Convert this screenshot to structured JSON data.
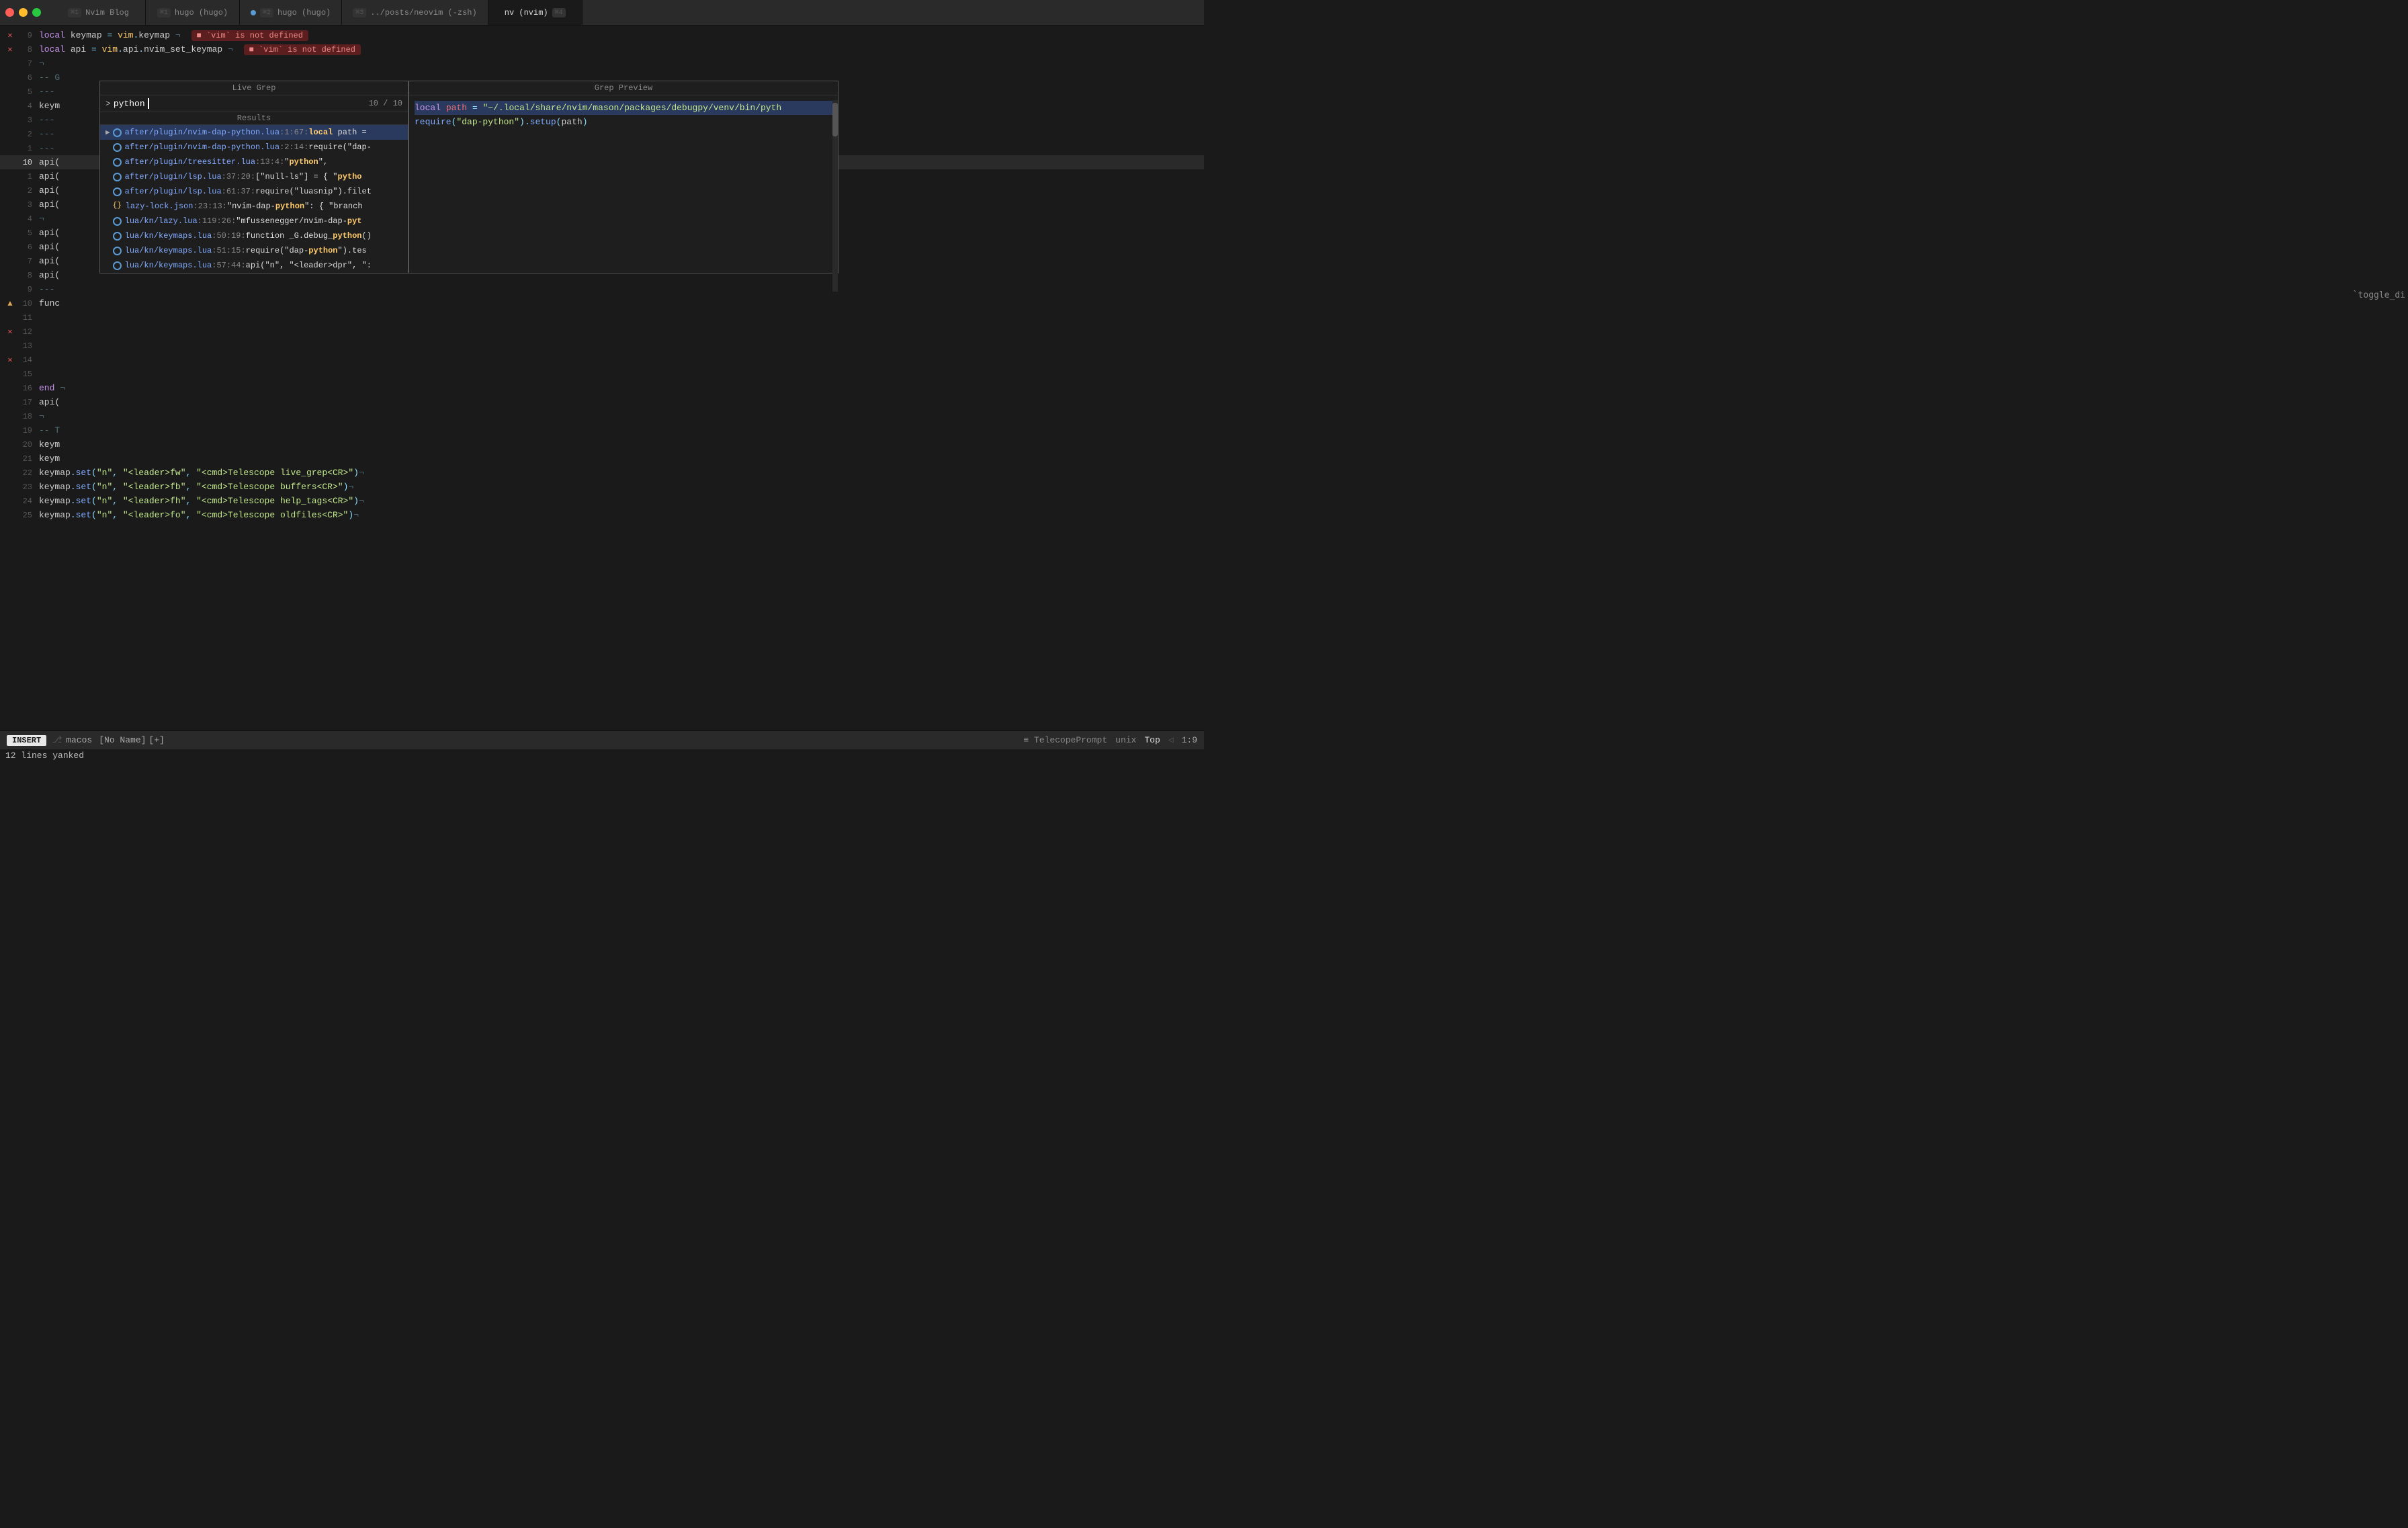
{
  "titlebar": {
    "tabs": [
      {
        "label": "Nvim Blog",
        "kbd": "⌘1",
        "active": false,
        "dot": false
      },
      {
        "label": "hugo (hugo)",
        "kbd": "⌘1",
        "active": false,
        "dot": false
      },
      {
        "label": "hugo (hugo)",
        "kbd": "⌘2",
        "active": false,
        "dot": true
      },
      {
        "label": "../posts/neovim (-zsh)",
        "kbd": "⌘3",
        "active": false,
        "dot": false
      },
      {
        "label": "nv (nvim)",
        "kbd": "⌘4",
        "active": true,
        "dot": false
      }
    ]
  },
  "editor": {
    "lines": [
      {
        "num": 9,
        "sign": "x",
        "content": "local keymap = vim.keymap",
        "error": "'vim' is not defined"
      },
      {
        "num": 8,
        "sign": "x",
        "content": "local api = vim.api.nvim_set_keymap",
        "error": "'vim' is not defined"
      },
      {
        "num": 7,
        "sign": "",
        "content": "¬"
      },
      {
        "num": 6,
        "sign": "",
        "content": "-- G"
      },
      {
        "num": 5,
        "sign": "",
        "content": "---"
      },
      {
        "num": 4,
        "sign": "",
        "content": "keym"
      },
      {
        "num": 3,
        "sign": "",
        "content": "---"
      },
      {
        "num": 2,
        "sign": "",
        "content": "---"
      },
      {
        "num": 1,
        "sign": "",
        "content": "---"
      },
      {
        "num": 10,
        "sign": "",
        "content": "api(",
        "current": true
      },
      {
        "num": 1,
        "sign": "",
        "content": "api("
      },
      {
        "num": 2,
        "sign": "",
        "content": "api("
      },
      {
        "num": 3,
        "sign": "",
        "content": "api("
      },
      {
        "num": 4,
        "sign": "",
        "content": "¬"
      },
      {
        "num": 5,
        "sign": "",
        "content": "api("
      },
      {
        "num": 6,
        "sign": "",
        "content": "api("
      },
      {
        "num": 7,
        "sign": "",
        "content": "api("
      },
      {
        "num": 8,
        "sign": "",
        "content": "api("
      },
      {
        "num": 9,
        "sign": "",
        "content": "---"
      },
      {
        "num": 10,
        "sign": "warn",
        "content": "func"
      },
      {
        "num": 11,
        "sign": "",
        "content": ""
      },
      {
        "num": 12,
        "sign": "x",
        "content": ""
      },
      {
        "num": 13,
        "sign": "",
        "content": ""
      },
      {
        "num": 14,
        "sign": "x",
        "content": ""
      },
      {
        "num": 15,
        "sign": "",
        "content": ""
      },
      {
        "num": 16,
        "sign": "",
        "content": "end ¬"
      },
      {
        "num": 17,
        "sign": "",
        "content": "api("
      },
      {
        "num": 18,
        "sign": "",
        "content": "¬"
      },
      {
        "num": 19,
        "sign": "",
        "content": "-- T"
      },
      {
        "num": 20,
        "sign": "",
        "content": "keym"
      },
      {
        "num": 21,
        "sign": "",
        "content": "keym"
      },
      {
        "num": 22,
        "sign": "",
        "content": "keymap.set(\"n\", \"<leader>fw\", \"<cmd>Telescope live_grep<CR>\")¬"
      },
      {
        "num": 23,
        "sign": "",
        "content": "keymap.set(\"n\", \"<leader>fb\", \"<cmd>Telescope buffers<CR>\")¬"
      },
      {
        "num": 24,
        "sign": "",
        "content": "keymap.set(\"n\", \"<leader>fh\", \"<cmd>Telescope help_tags<CR>\")¬"
      },
      {
        "num": 25,
        "sign": "",
        "content": "keymap.set(\"n\", \"<leader>fo\", \"<cmd>Telescope oldfiles<CR>\")¬"
      }
    ]
  },
  "telescope": {
    "live_grep": {
      "title": "Live Grep",
      "query": "python",
      "count": "10 / 10"
    },
    "results": {
      "title": "Results",
      "items": [
        {
          "selected": true,
          "file": "after/plugin/nvim-dap-python.lua",
          "loc": "1:67:",
          "text": "local path ="
        },
        {
          "selected": false,
          "file": "after/plugin/nvim-dap-python.lua",
          "loc": "2:14:",
          "text": "require(\"dap-"
        },
        {
          "selected": false,
          "file": "after/plugin/treesitter.lua",
          "loc": "13:4:",
          "text": "\"python\","
        },
        {
          "selected": false,
          "file": "after/plugin/lsp.lua",
          "loc": "37:20:",
          "text": "[\"null-ls\"] = { \"pytho"
        },
        {
          "selected": false,
          "file": "after/plugin/lsp.lua",
          "loc": "61:37:",
          "text": "require(\"luasnip\").filet"
        },
        {
          "selected": false,
          "file": "{} lazy-lock.json",
          "loc": "23:13:",
          "text": "\"nvim-dap-python\": { \"branch"
        },
        {
          "selected": false,
          "file": "lua/kn/lazy.lua",
          "loc": "119:26:",
          "text": "\"mfussenegger/nvim-dap-pyt"
        },
        {
          "selected": false,
          "file": "lua/kn/keymaps.lua",
          "loc": "50:19:",
          "text": "function _G.debug_python()"
        },
        {
          "selected": false,
          "file": "lua/kn/keymaps.lua",
          "loc": "51:15:",
          "text": "require(\"dap-python\").tes"
        },
        {
          "selected": false,
          "file": "lua/kn/keymaps.lua",
          "loc": "57:44:",
          "text": "api(\"n\", \"<leader>dpr\", \":"
        }
      ]
    },
    "preview": {
      "title": "Grep Preview",
      "line1": "local path = \"~/.local/share/nvim/mason/packages/debugpy/venv/bin/pyth",
      "line2": "require(\"dap-python\").setup(path)"
    }
  },
  "statusbar": {
    "mode": "INSERT",
    "branch": "macos",
    "file": "[No Name]",
    "modified": "[+]",
    "filetype": "TelecopePrompt",
    "encoding": "unix",
    "position_label": "Top",
    "position": "1:9"
  },
  "msgline": {
    "text": "12 lines yanked"
  }
}
